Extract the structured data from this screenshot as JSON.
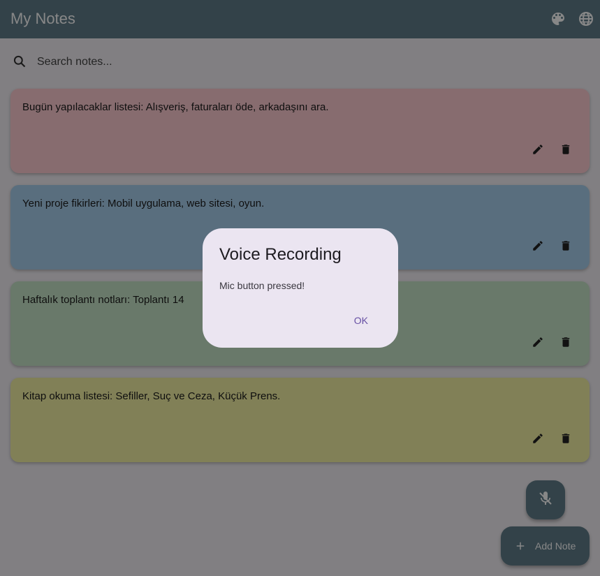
{
  "appbar": {
    "title": "My Notes",
    "icons": [
      "palette-icon",
      "language-icon"
    ]
  },
  "search": {
    "placeholder": "Search notes...",
    "value": ""
  },
  "notes": [
    {
      "text": "Bugün yapılacaklar listesi: Alışveriş, faturaları öde, arkadaşını ara.",
      "color": "#ffcdd2"
    },
    {
      "text": "Yeni proje fikirleri: Mobil uygulama, web sitesi, oyun.",
      "color": "#a9d0ee"
    },
    {
      "text": "Haftalık toplantı notları: Toplantı 14",
      "color": "#c7e5c8"
    },
    {
      "text": "Kitap okuma listesi: Sefiller, Suç ve Ceza, Küçük Prens.",
      "color": "#f4f1a5"
    }
  ],
  "fab": {
    "mic_icon": "mic-off-icon",
    "add_label": "Add Note"
  },
  "dialog": {
    "title": "Voice Recording",
    "message": "Mic button pressed!",
    "ok_label": "OK"
  },
  "colors": {
    "appbar": "#607d8b",
    "dialog_bg": "#ebe5f1",
    "dialog_action": "#6750a4"
  }
}
